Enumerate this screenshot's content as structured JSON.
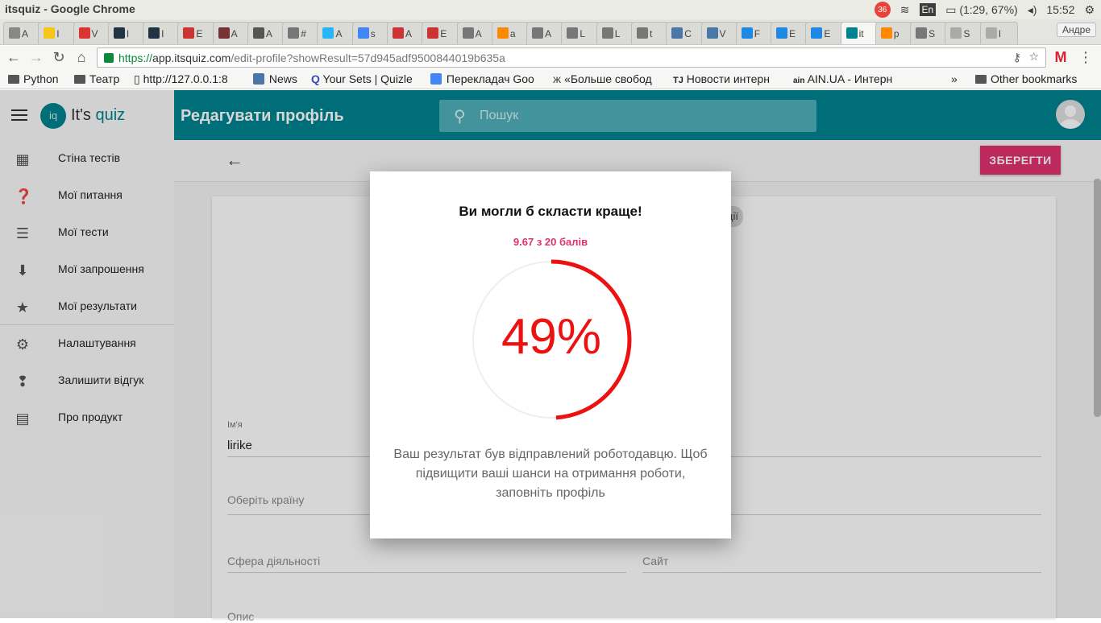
{
  "os": {
    "title": "itsquiz - Google Chrome",
    "notif_count": "36",
    "keyboard": "En",
    "battery": "(1:29, 67%)",
    "time": "15:52"
  },
  "browser": {
    "tabs": [
      {
        "label": "A"
      },
      {
        "label": "I"
      },
      {
        "label": "V"
      },
      {
        "label": "I"
      },
      {
        "label": "I"
      },
      {
        "label": "E"
      },
      {
        "label": "A"
      },
      {
        "label": "A"
      },
      {
        "label": "#"
      },
      {
        "label": "A"
      },
      {
        "label": "s"
      },
      {
        "label": "A"
      },
      {
        "label": "E"
      },
      {
        "label": "A"
      },
      {
        "label": "a"
      },
      {
        "label": "A"
      },
      {
        "label": "L"
      },
      {
        "label": "L"
      },
      {
        "label": "t"
      },
      {
        "label": "C"
      },
      {
        "label": "V"
      },
      {
        "label": "F"
      },
      {
        "label": "E"
      },
      {
        "label": "E"
      },
      {
        "label": "it"
      },
      {
        "label": "p"
      },
      {
        "label": "S"
      },
      {
        "label": "S"
      },
      {
        "label": "I"
      }
    ],
    "user_name": "Андре",
    "url_scheme": "https://",
    "url_host": "app.itsquiz.com",
    "url_path": "/edit-profile?showResult=57d945adf9500844019b635a",
    "bookmarks": [
      "Python",
      "Театр",
      "http://127.0.0.1:8",
      "News",
      "Your Sets | Quizle",
      "Перекладач Goo",
      "«Больше свобод",
      "Новости интерн",
      "AIN.UA - Интерн"
    ],
    "bookmarks_more": "»",
    "other_bookmarks": "Other bookmarks"
  },
  "app": {
    "logo_mark": "iq",
    "logo_its": "It's",
    "logo_quiz": " quiz",
    "page_title": "Редагувати профіль",
    "search_placeholder": "Пошук",
    "save_label": "ЗБЕРЕГТИ",
    "sidebar": [
      {
        "label": "Стіна тестів",
        "icon": "dashboard-icon"
      },
      {
        "label": "Мої питання",
        "icon": "help-icon"
      },
      {
        "label": "Мої тести",
        "icon": "list-icon"
      },
      {
        "label": "Мої запрошення",
        "icon": "inbox-icon"
      },
      {
        "label": "Мої результати",
        "icon": "star-icon"
      },
      {
        "label": "Налаштування",
        "icon": "gear-icon"
      },
      {
        "label": "Залишити відгук",
        "icon": "feedback-icon"
      },
      {
        "label": "Про продукт",
        "icon": "clipboard-icon"
      }
    ],
    "form": {
      "chip_fragment": "ції",
      "name_label": "Ім'я",
      "name_value": "lirike",
      "country_placeholder": "Оберіть країну",
      "sphere_placeholder": "Сфера діяльності",
      "site_placeholder": "Сайт",
      "about_placeholder": "Опис"
    }
  },
  "modal": {
    "heading": "Ви могли б скласти краще!",
    "score": "9.67 з 20 балів",
    "percent": "49%",
    "progress_fraction": 0.49,
    "ring_color": "#ee1111",
    "description": "Ваш результат був відправлений роботодавцю. Щоб підвищити ваші шанси на отримання роботи, заповніть профіль"
  },
  "colors": {
    "brand": "#00838f",
    "accent": "#e0316f"
  }
}
